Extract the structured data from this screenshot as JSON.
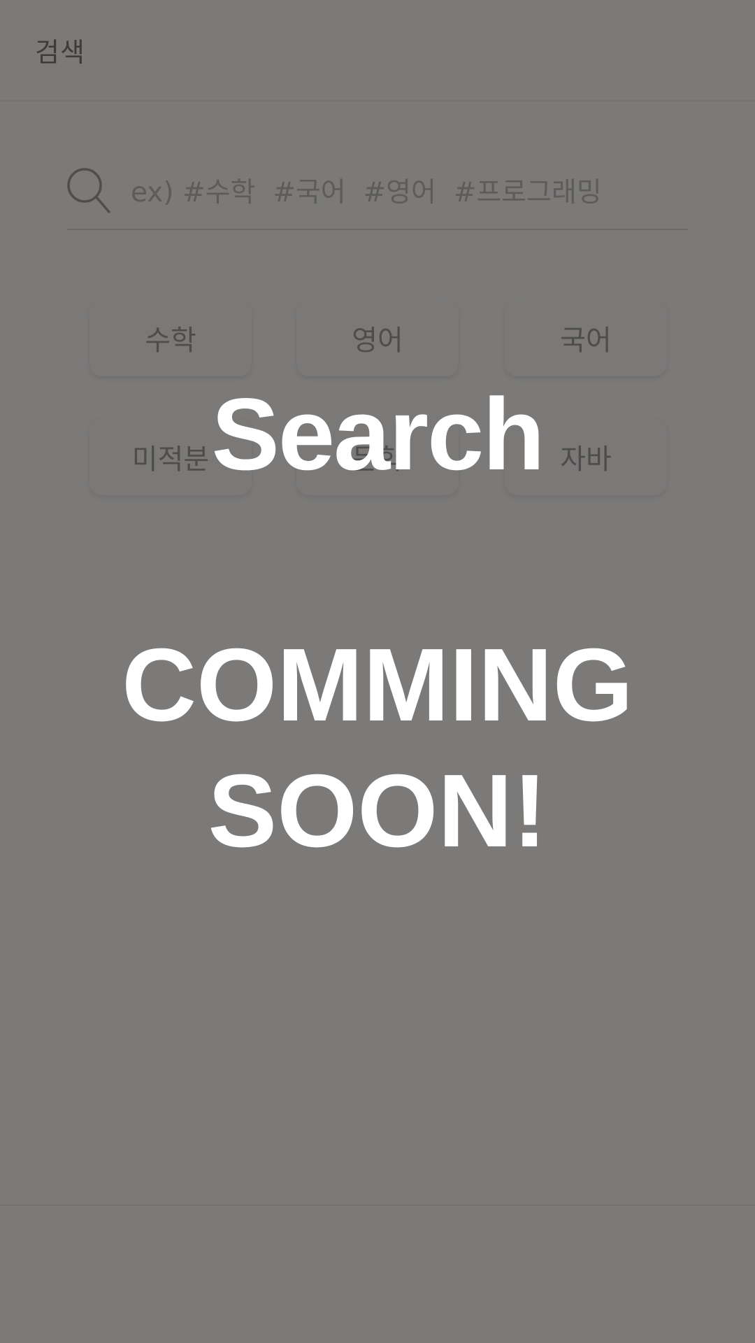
{
  "header": {
    "title": "검색"
  },
  "search": {
    "placeholder": "ex) #수학  #국어  #영어  #프로그래밍",
    "icon": "search-icon"
  },
  "tags": [
    {
      "label": "수학"
    },
    {
      "label": "영어"
    },
    {
      "label": "국어"
    },
    {
      "label": "미적분"
    },
    {
      "label": "문학"
    },
    {
      "label": "자바"
    }
  ],
  "overlay": {
    "title": "Search",
    "message_line1": "COMMING",
    "message_line2": "SOON!"
  },
  "colors": {
    "overlay_background": "#7b7a79",
    "overlay_text": "#ffffff"
  }
}
